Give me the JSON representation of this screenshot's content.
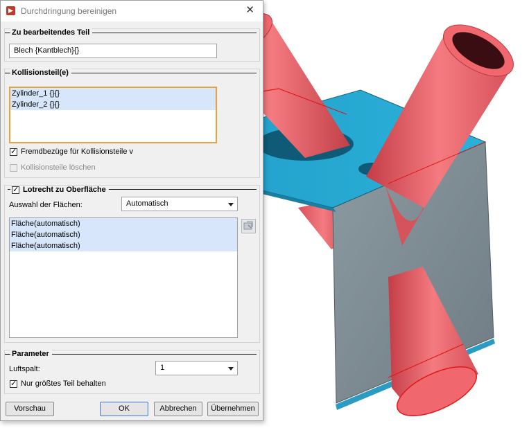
{
  "window": {
    "title": "Durchdringung bereinigen"
  },
  "part_group": {
    "legend": "Zu bearbeitendes Teil",
    "value": "Blech {Kantblech}{}"
  },
  "collision_group": {
    "legend": "Kollisionsteil(e)",
    "items": [
      "Zylinder_1 {}{}",
      "Zylinder_2 {}{}"
    ],
    "fremd_checkbox": {
      "label": "Fremdbezüge für Kollisionsteile v",
      "checked": true
    },
    "delete_checkbox": {
      "label": "Kollisionsteile löschen",
      "checked": false,
      "disabled": true
    }
  },
  "surface_group": {
    "legend": "Lotrecht zu Oberfläche",
    "checked": true,
    "select_label": "Auswahl der Flächen:",
    "select_value": "Automatisch",
    "items": [
      "Fläche(automatisch)",
      "Fläche(automatisch)",
      "Fläche(automatisch)"
    ],
    "side_button_icon": "pick-surface-icon"
  },
  "param_group": {
    "legend": "Parameter",
    "gap_label": "Luftspalt:",
    "gap_value": "1",
    "keep_checkbox": {
      "label": "Nur größtes Teil behalten",
      "checked": true
    }
  },
  "buttons": {
    "preview": "Vorschau",
    "ok": "OK",
    "cancel": "Abbrechen",
    "apply": "Übernehmen"
  },
  "colors": {
    "plate": "#2aa0c8",
    "plate_edge": "#1c6f8e",
    "plate_side": "#7f8c95",
    "cylinder": "#f0686d",
    "cylinder_dark": "#c9434b",
    "cut_line": "#e01818"
  }
}
